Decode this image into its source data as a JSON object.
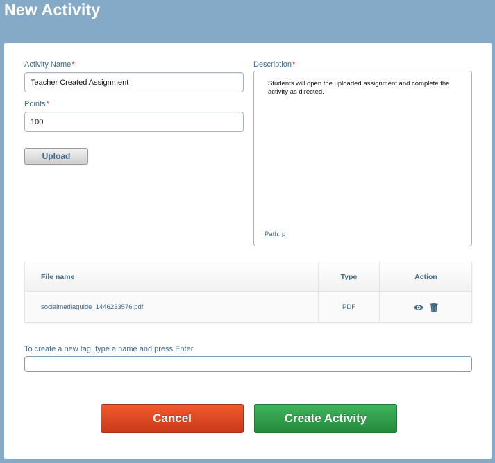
{
  "page": {
    "title": "New Activity"
  },
  "form": {
    "activity_name": {
      "label": "Activity Name",
      "required_mark": "*",
      "value": "Teacher Created Assignment"
    },
    "points": {
      "label": "Points",
      "required_mark": "*",
      "value": "100"
    },
    "upload_label": "Upload",
    "description": {
      "label": "Description",
      "required_mark": "*",
      "value": "Students will open the uploaded assignment and complete the activity as directed.",
      "path": "Path: p"
    }
  },
  "files_table": {
    "headers": {
      "file_name": "File name",
      "type": "Type",
      "action": "Action"
    },
    "rows": [
      {
        "file_name": "socialmediaguide_1446233576.pdf",
        "type": "PDF"
      }
    ],
    "icons": {
      "view": "eye-icon",
      "delete": "trash-icon"
    }
  },
  "tags": {
    "label": "To create a new tag, type a name and press Enter.",
    "value": ""
  },
  "buttons": {
    "cancel": "Cancel",
    "create": "Create Activity"
  },
  "colors": {
    "header_bg": "#84aac8",
    "label": "#3f6a8a",
    "required": "#c0392b",
    "cancel": "#e5492a",
    "create": "#34a050"
  }
}
